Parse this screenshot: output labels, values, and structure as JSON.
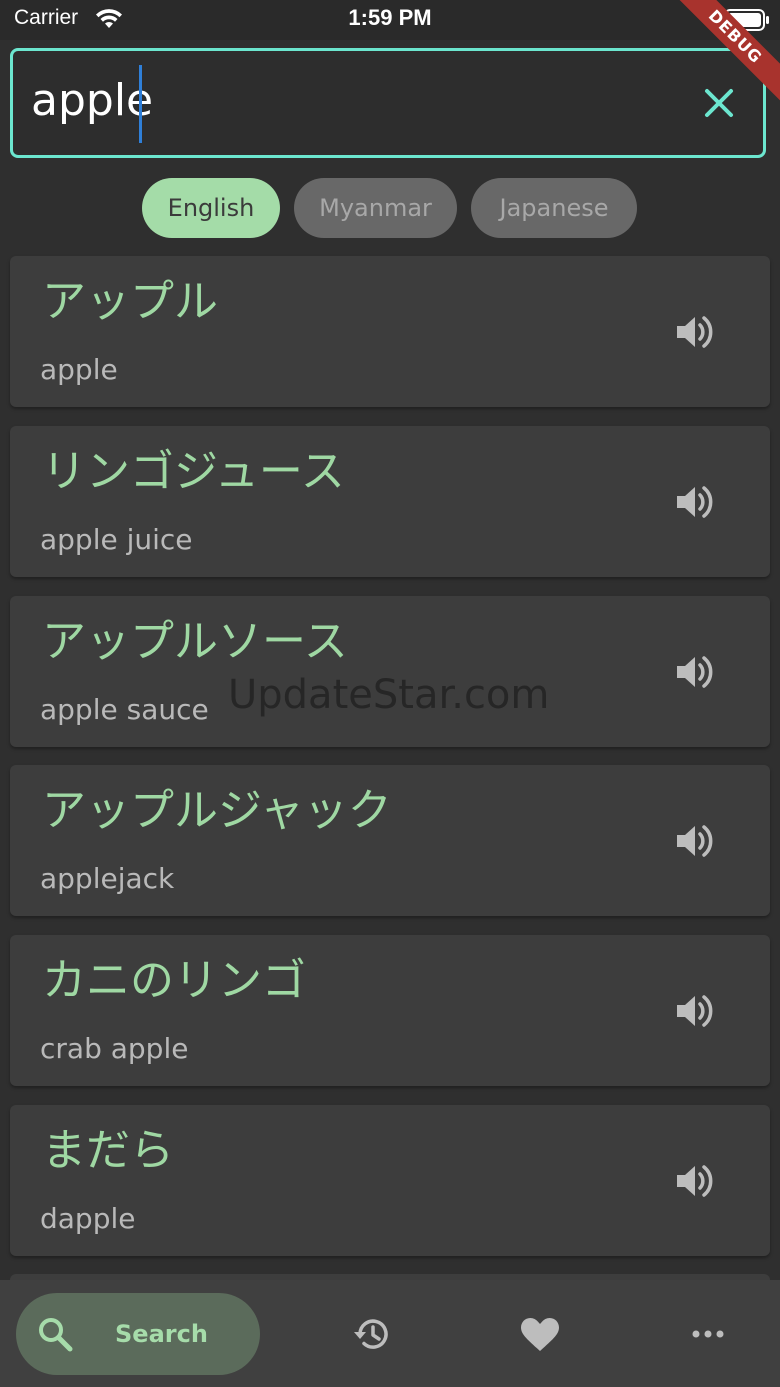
{
  "status_bar": {
    "carrier": "Carrier",
    "time": "1:59 PM"
  },
  "debug_banner": "DEBUG",
  "search": {
    "value": "apple"
  },
  "language_chips": [
    {
      "label": "English",
      "selected": true
    },
    {
      "label": "Myanmar",
      "selected": false
    },
    {
      "label": "Japanese",
      "selected": false
    }
  ],
  "results": [
    {
      "japanese": "アップル",
      "english": "apple"
    },
    {
      "japanese": "リンゴジュース",
      "english": "apple juice"
    },
    {
      "japanese": "アップルソース",
      "english": "apple sauce"
    },
    {
      "japanese": "アップルジャック",
      "english": "applejack"
    },
    {
      "japanese": "カニのリンゴ",
      "english": "crab apple"
    },
    {
      "japanese": "まだら",
      "english": "dapple"
    }
  ],
  "watermark": "UpdateStar.com",
  "bottom_nav": {
    "search_label": "Search",
    "items": [
      "search-icon",
      "history-icon",
      "heart-icon",
      "more-icon"
    ]
  },
  "colors": {
    "accent": "#6ce6cf",
    "primary_green": "#9fd8a3",
    "chip_selected": "#a4dca8",
    "background": "#2f2f2f",
    "card": "#3d3d3d"
  }
}
